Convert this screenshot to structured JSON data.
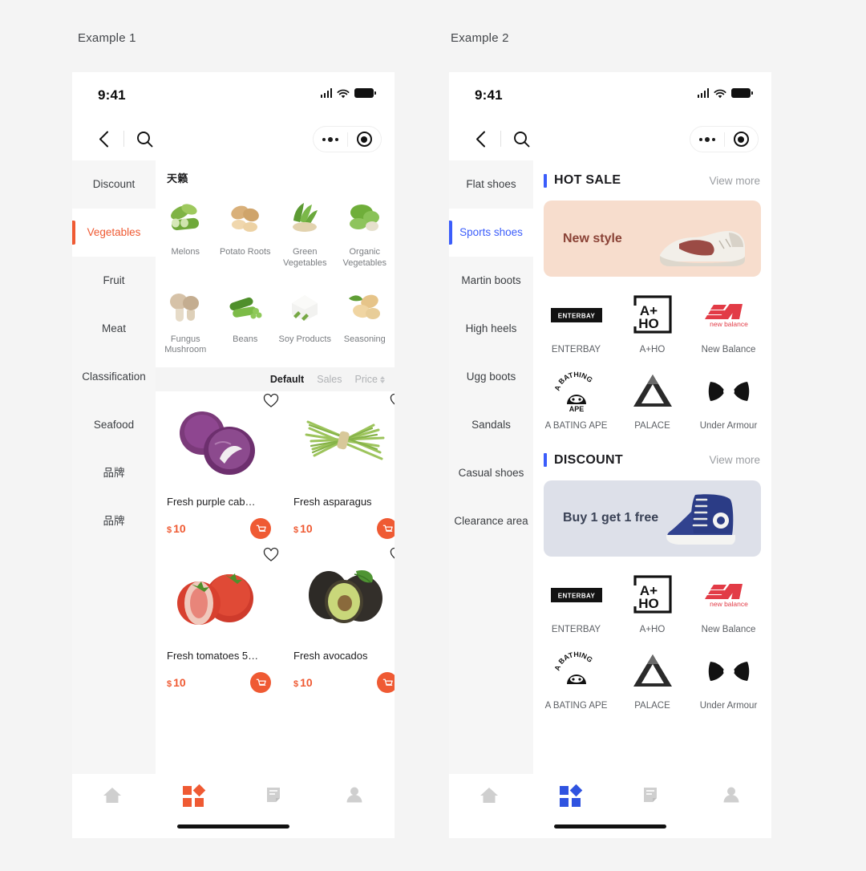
{
  "page": {
    "background": "#f4f4f4",
    "example1_label": "Example 1",
    "example2_label": "Example 2"
  },
  "statusbar": {
    "time": "9:41",
    "signal_icon": "cellular-signal-icon",
    "wifi_icon": "wifi-icon",
    "battery_icon": "battery-icon"
  },
  "navbar": {
    "back_icon": "back-chevron-icon",
    "search_icon": "search-icon",
    "more_icon": "more-dots-icon",
    "capsule_target_icon": "target-circle-icon"
  },
  "example1": {
    "accent": "#ef5a33",
    "sidebar": {
      "items": [
        {
          "label": "Discount",
          "active": false
        },
        {
          "label": "Vegetables",
          "active": true
        },
        {
          "label": "Fruit",
          "active": false
        },
        {
          "label": "Meat",
          "active": false
        },
        {
          "label": "Classification",
          "active": false
        },
        {
          "label": "Seafood",
          "active": false
        },
        {
          "label": "品牌",
          "active": false
        },
        {
          "label": "品牌",
          "active": false
        }
      ]
    },
    "category_panel": {
      "title": "天籁",
      "items": [
        {
          "label": "Melons",
          "icon": "melons-thumb"
        },
        {
          "label": "Potato Roots",
          "icon": "potato-roots-thumb"
        },
        {
          "label": "Green Vegetables",
          "icon": "green-vegetables-thumb"
        },
        {
          "label": "Organic Vegetables",
          "icon": "organic-vegetables-thumb"
        },
        {
          "label": "Fungus Mushroom",
          "icon": "fungus-mushroom-thumb"
        },
        {
          "label": "Beans",
          "icon": "beans-thumb"
        },
        {
          "label": "Soy Products",
          "icon": "soy-products-thumb"
        },
        {
          "label": "Seasoning",
          "icon": "seasoning-thumb"
        }
      ]
    },
    "sortbar": {
      "options": [
        {
          "label": "Default",
          "active": true,
          "has_arrows": false
        },
        {
          "label": "Sales",
          "active": false,
          "has_arrows": false
        },
        {
          "label": "Price",
          "active": false,
          "has_arrows": true
        }
      ]
    },
    "products": [
      {
        "name": "Fresh purple cab…",
        "currency": "$",
        "price": "10",
        "image": "purple-cabbage-photo",
        "favorite_icon": "heart-outline-icon",
        "cart_icon": "cart-icon"
      },
      {
        "name": "Fresh asparagus",
        "currency": "$",
        "price": "10",
        "image": "asparagus-photo",
        "favorite_icon": "heart-outline-icon",
        "cart_icon": "cart-icon"
      },
      {
        "name": "Fresh tomatoes 5…",
        "currency": "$",
        "price": "10",
        "image": "tomatoes-photo",
        "favorite_icon": "heart-outline-icon",
        "cart_icon": "cart-icon"
      },
      {
        "name": "Fresh avocados",
        "currency": "$",
        "price": "10",
        "image": "avocado-photo",
        "favorite_icon": "heart-outline-icon",
        "cart_icon": "cart-icon"
      }
    ],
    "tabbar": {
      "items": [
        {
          "icon": "home-icon",
          "active": false
        },
        {
          "icon": "category-grid-icon",
          "active": true
        },
        {
          "icon": "order-list-icon",
          "active": false
        },
        {
          "icon": "profile-person-icon",
          "active": false
        }
      ]
    }
  },
  "example2": {
    "accent": "#3b5dfb",
    "sidebar": {
      "items": [
        {
          "label": "Flat shoes",
          "active": false
        },
        {
          "label": "Sports shoes",
          "active": true
        },
        {
          "label": "Martin boots",
          "active": false
        },
        {
          "label": "High heels",
          "active": false
        },
        {
          "label": "Ugg boots",
          "active": false
        },
        {
          "label": "Sandals",
          "active": false
        },
        {
          "label": "Casual shoes",
          "active": false
        },
        {
          "label": "Clearance area",
          "active": false
        }
      ]
    },
    "sections": [
      {
        "title": "HOT SALE",
        "more_label": "View more",
        "banner": {
          "text": "New style",
          "bg": "#f7ddcd",
          "image": "running-shoe-photo"
        },
        "brands": [
          {
            "name": "ENTERBAY",
            "logo": "enterbay-logo"
          },
          {
            "name": "A+HO",
            "logo": "a-plus-ho-logo"
          },
          {
            "name": "New Balance",
            "logo": "new-balance-logo"
          },
          {
            "name": "A BATING APE",
            "logo": "bathing-ape-logo"
          },
          {
            "name": "PALACE",
            "logo": "palace-logo"
          },
          {
            "name": "Under Armour",
            "logo": "under-armour-logo"
          }
        ]
      },
      {
        "title": "DISCOUNT",
        "more_label": "View more",
        "banner": {
          "text": "Buy 1 get 1 free",
          "bg": "#dde0e9",
          "image": "blue-high-top-sneaker-photo"
        },
        "brands": [
          {
            "name": "ENTERBAY",
            "logo": "enterbay-logo"
          },
          {
            "name": "A+HO",
            "logo": "a-plus-ho-logo"
          },
          {
            "name": "New Balance",
            "logo": "new-balance-logo"
          },
          {
            "name": "A BATING APE",
            "logo": "bathing-ape-logo"
          },
          {
            "name": "PALACE",
            "logo": "palace-logo"
          },
          {
            "name": "Under Armour",
            "logo": "under-armour-logo"
          }
        ]
      }
    ],
    "tabbar": {
      "items": [
        {
          "icon": "home-icon",
          "active": false
        },
        {
          "icon": "category-grid-icon",
          "active": true
        },
        {
          "icon": "order-list-icon",
          "active": false
        },
        {
          "icon": "profile-person-icon",
          "active": false
        }
      ]
    }
  }
}
